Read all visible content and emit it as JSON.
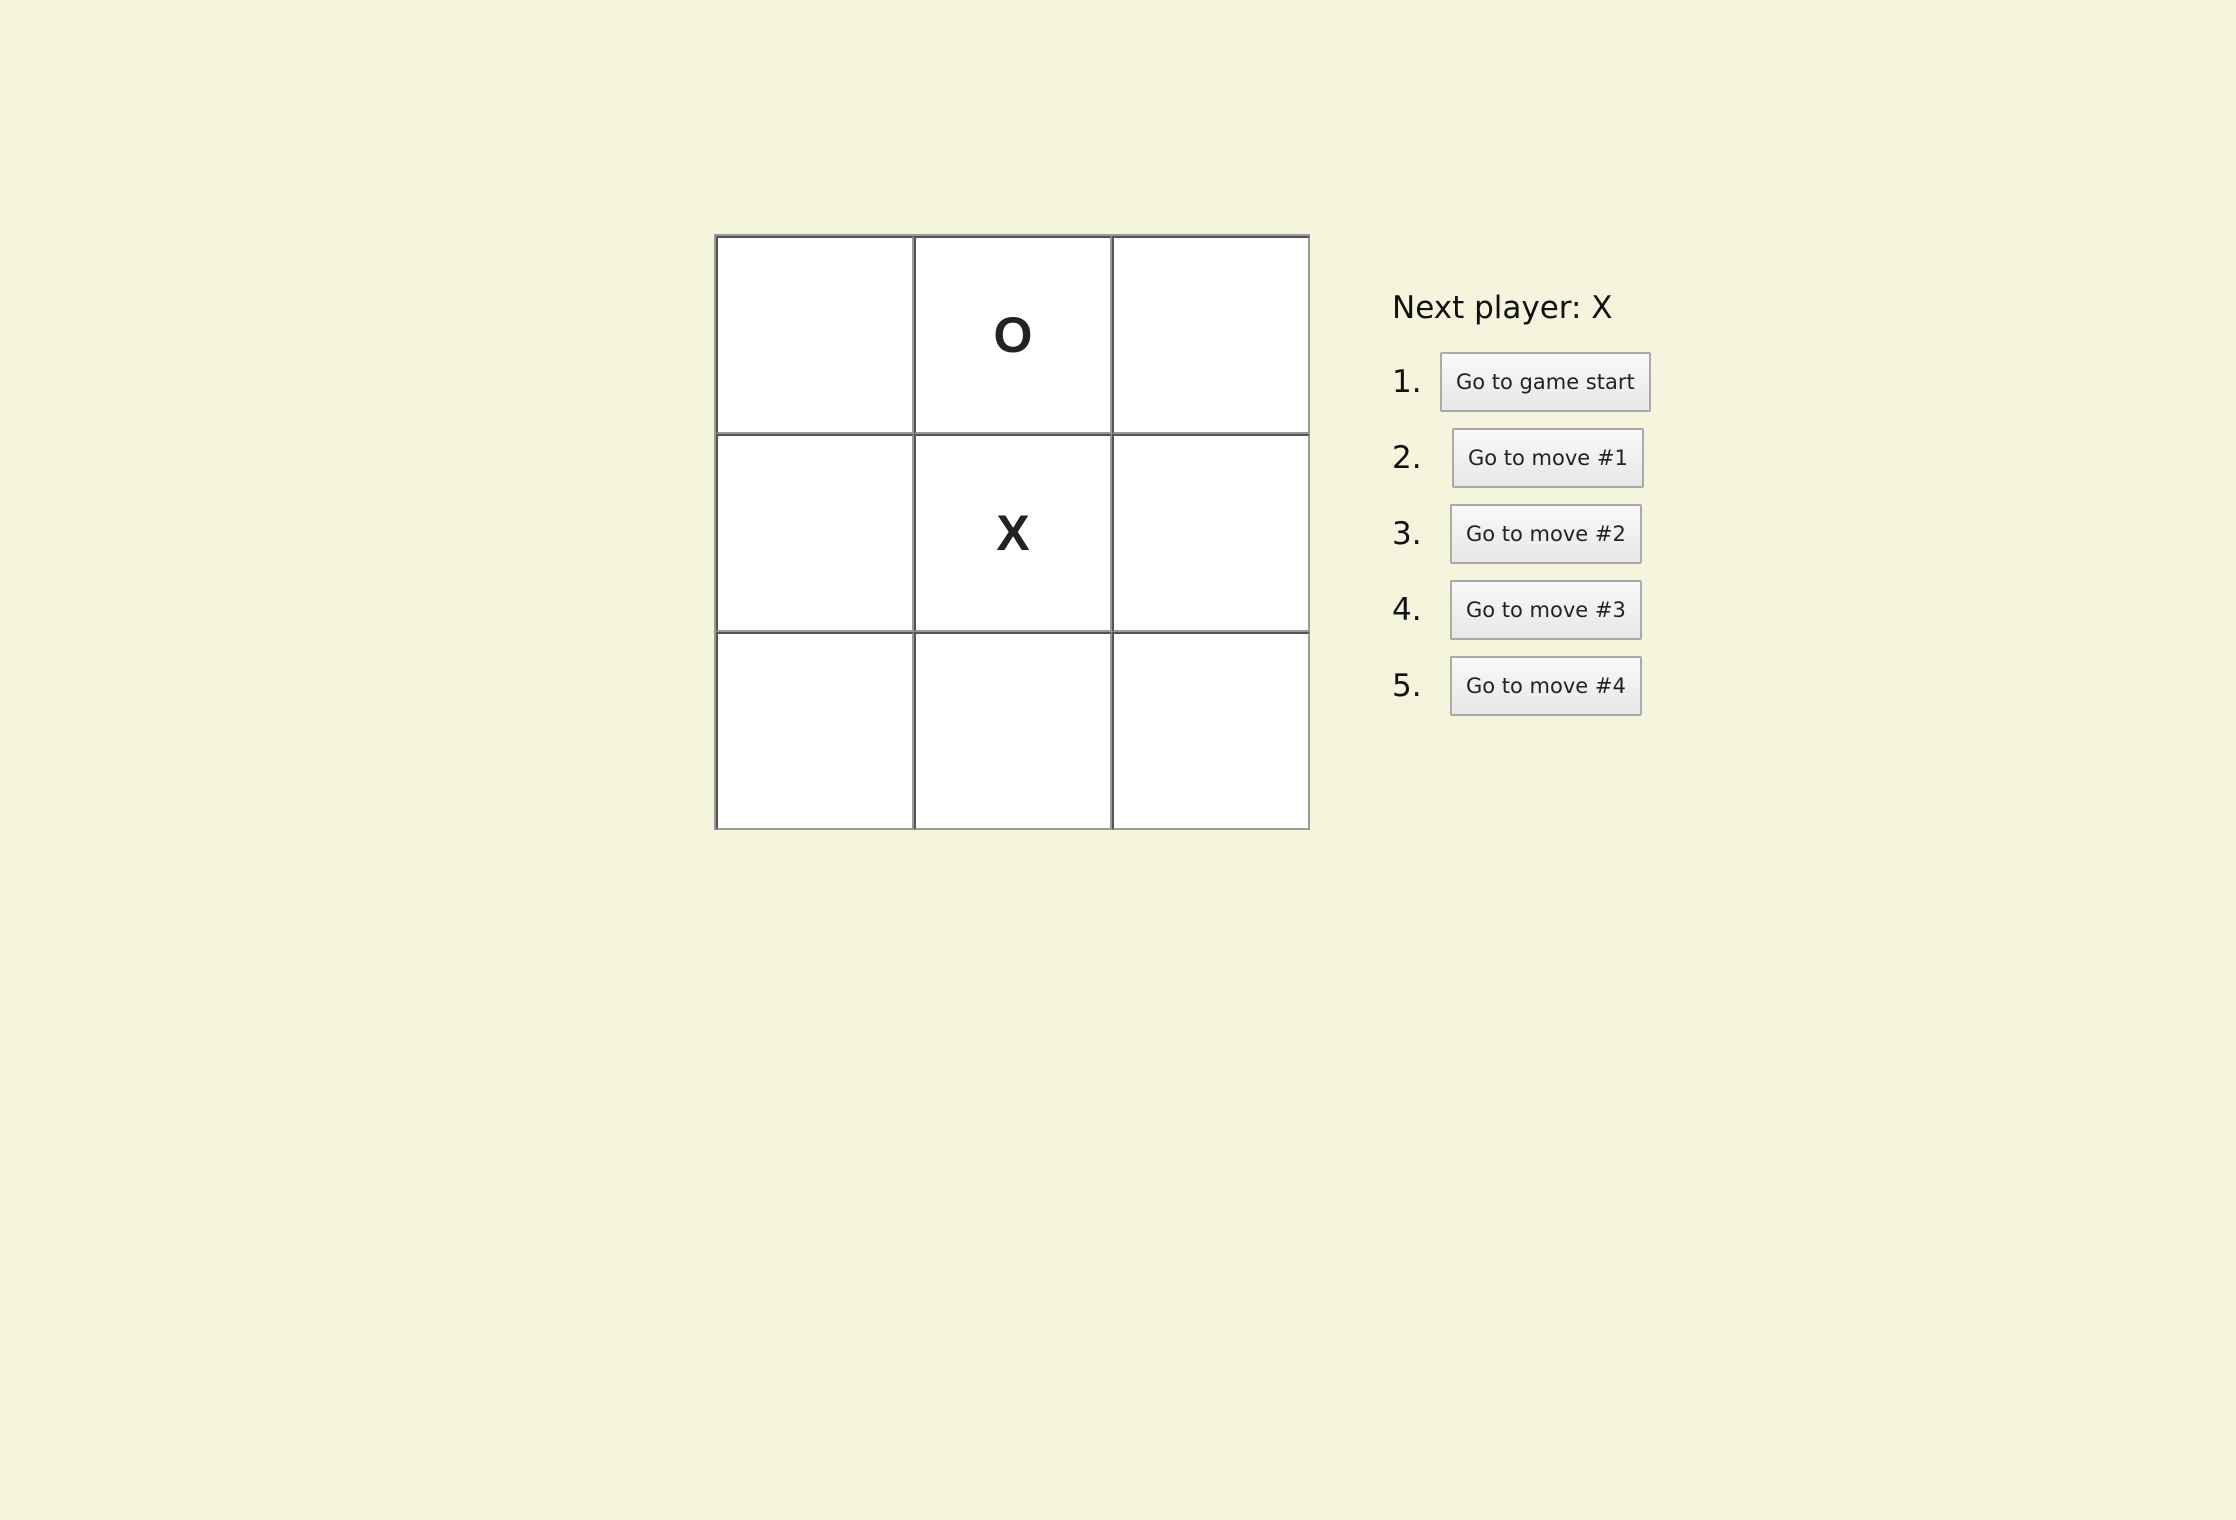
{
  "board": {
    "squares": [
      "",
      "O",
      "",
      "",
      "X",
      "",
      "",
      "",
      ""
    ]
  },
  "info": {
    "status": "Next player: X",
    "moves": [
      {
        "number": "1.",
        "label": "Go to game start"
      },
      {
        "number": "2.",
        "label": "Go to move #1"
      },
      {
        "number": "3.",
        "label": "Go to move #2"
      },
      {
        "number": "4.",
        "label": "Go to move #3"
      },
      {
        "number": "5.",
        "label": "Go to move #4"
      }
    ]
  },
  "colors": {
    "background": "#f5f5dd",
    "square": "#ffffff",
    "border": "#999999"
  }
}
